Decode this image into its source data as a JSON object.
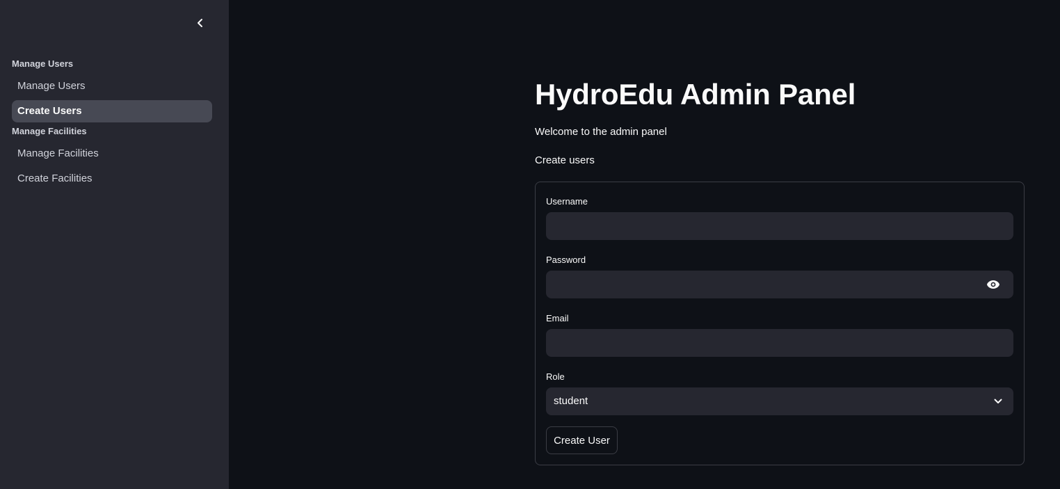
{
  "sidebar": {
    "sections": [
      {
        "title": "Manage Users",
        "items": [
          {
            "label": "Manage Users",
            "active": false
          },
          {
            "label": "Create Users",
            "active": true
          }
        ]
      },
      {
        "title": "Manage Facilities",
        "items": [
          {
            "label": "Manage Facilities",
            "active": false
          },
          {
            "label": "Create Facilities",
            "active": false
          }
        ]
      }
    ],
    "collapse_icon": "chevron-left-icon"
  },
  "main": {
    "title": "HydroEdu Admin Panel",
    "welcome": "Welcome to the admin panel",
    "subheading": "Create users"
  },
  "form": {
    "username": {
      "label": "Username",
      "value": "",
      "placeholder": ""
    },
    "password": {
      "label": "Password",
      "value": "",
      "placeholder": "",
      "toggle_icon": "eye-icon"
    },
    "email": {
      "label": "Email",
      "value": "",
      "placeholder": ""
    },
    "role": {
      "label": "Role",
      "selected": "student",
      "icon": "chevron-down-icon"
    },
    "submit_label": "Create User"
  },
  "colors": {
    "background": "#0e1117",
    "sidebar": "#262730",
    "input": "#262730",
    "active_nav": "#474954",
    "text": "#fafafa",
    "border": "#3b3d45"
  }
}
